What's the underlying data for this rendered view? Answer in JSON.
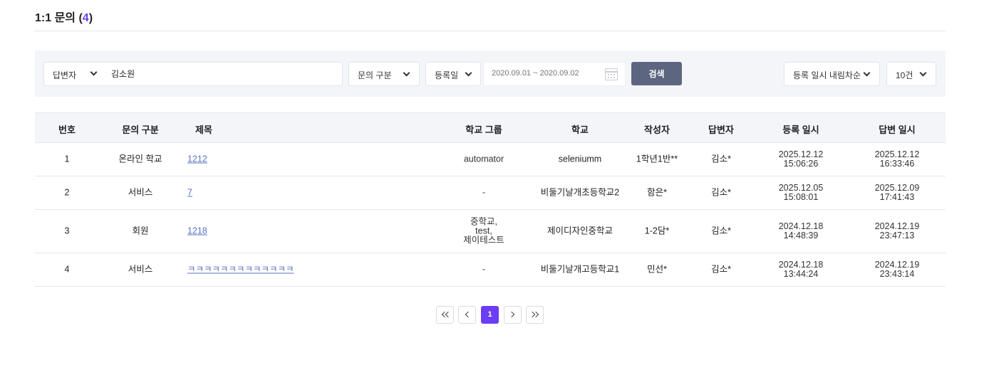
{
  "header": {
    "title": "1:1 문의",
    "count_open": " (",
    "count": "4",
    "count_close": ")"
  },
  "filters": {
    "answerer_label": "답변자",
    "answerer_value": "김소원",
    "type_label": "문의 구분",
    "date_type_label": "등록일",
    "date_range_placeholder": "2020.09.01 ~ 2020.09.02",
    "search_label": "검색",
    "sort_label": "등록 일시 내림차순",
    "page_size_label": "10건"
  },
  "table": {
    "columns": [
      "번호",
      "문의 구분",
      "제목",
      "학교 그룹",
      "학교",
      "작성자",
      "답변자",
      "등록 일시",
      "답변 일시"
    ],
    "rows": [
      {
        "no": "1",
        "type": "온라인 학교",
        "title": "1212",
        "group": "automator",
        "school": "seleniumm",
        "author": "1학년1반**",
        "answerer": "김소*",
        "registered": "2025.12.12\n15:06:26",
        "answered": "2025.12.12\n16:33:46"
      },
      {
        "no": "2",
        "type": "서비스",
        "title": "7",
        "group": "-",
        "school": "비둘기날개초등학교2",
        "author": "함은*",
        "answerer": "김소*",
        "registered": "2025.12.05\n15:08:01",
        "answered": "2025.12.09\n17:41:43"
      },
      {
        "no": "3",
        "type": "회원",
        "title": "1218",
        "group": "중학교,\ntest,\n제이테스트",
        "school": "제이디자인중학교",
        "author": "1-2담*",
        "answerer": "김소*",
        "registered": "2024.12.18\n14:48:39",
        "answered": "2024.12.19\n23:47:13"
      },
      {
        "no": "4",
        "type": "서비스",
        "title": "ㅋㅋㅋㅋㅋㅋㅋㅋㅋㅋㅋㅋㅋ",
        "group": "-",
        "school": "비둘기날개고등학교1",
        "author": "민선*",
        "answerer": "김소*",
        "registered": "2024.12.18\n13:44:24",
        "answered": "2024.12.19\n23:43:14"
      }
    ]
  },
  "pagination": {
    "current": "1"
  },
  "colors": {
    "accent": "#6c3df4",
    "search_button": "#5d6680",
    "link": "#5b73c6",
    "panel_bg": "#f4f5f9"
  },
  "icons": [
    "chevron-down-icon",
    "calendar-icon",
    "double-chevron-left-icon",
    "chevron-left-icon",
    "chevron-right-icon",
    "double-chevron-right-icon"
  ]
}
